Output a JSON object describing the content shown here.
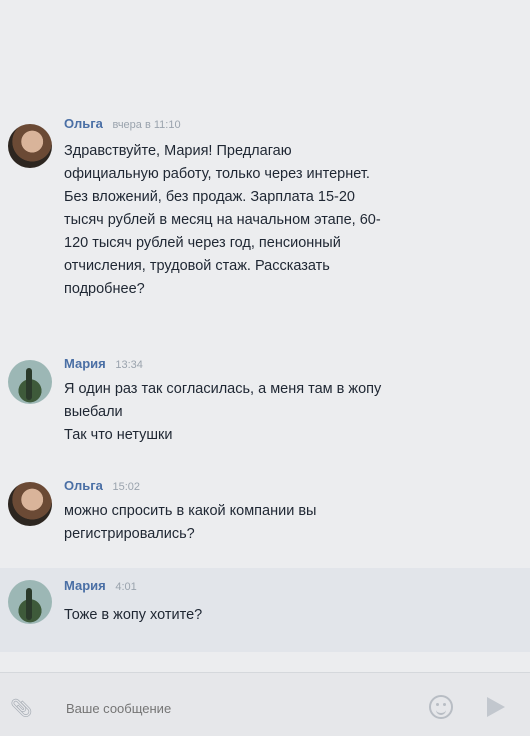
{
  "messages": [
    {
      "author": "Ольга",
      "time": "вчера в 11:10",
      "text": "Здравствуйте, Мария! Предлагаю\nофициальную работу, только через интернет.\nБез вложений, без продаж. Зарплата 15-20\nтысяч рублей в месяц на начальном этапе, 60-\n120 тысяч рублей через год, пенсионный\nотчисления, трудовой стаж. Рассказать\nподробнее?"
    },
    {
      "author": "Мария",
      "time": "13:34",
      "text": "Я один раз так согласилась, а меня там в жопу\nвыебали\nТак что нетушки"
    },
    {
      "author": "Ольга",
      "time": "15:02",
      "text": "можно спросить в какой компании вы\nрегистрировались?"
    },
    {
      "author": "Мария",
      "time": "4:01",
      "text": "Тоже в жопу хотите?"
    }
  ],
  "composer": {
    "placeholder": "Ваше сообщение",
    "attach_icon": "paperclip-icon",
    "emoji_icon": "smile-icon",
    "send_icon": "send-arrow-icon"
  },
  "colors": {
    "background": "#ecedef",
    "author_name": "#4a6fa5",
    "timestamp": "#9aa3ad",
    "message_text": "#1f2733"
  }
}
